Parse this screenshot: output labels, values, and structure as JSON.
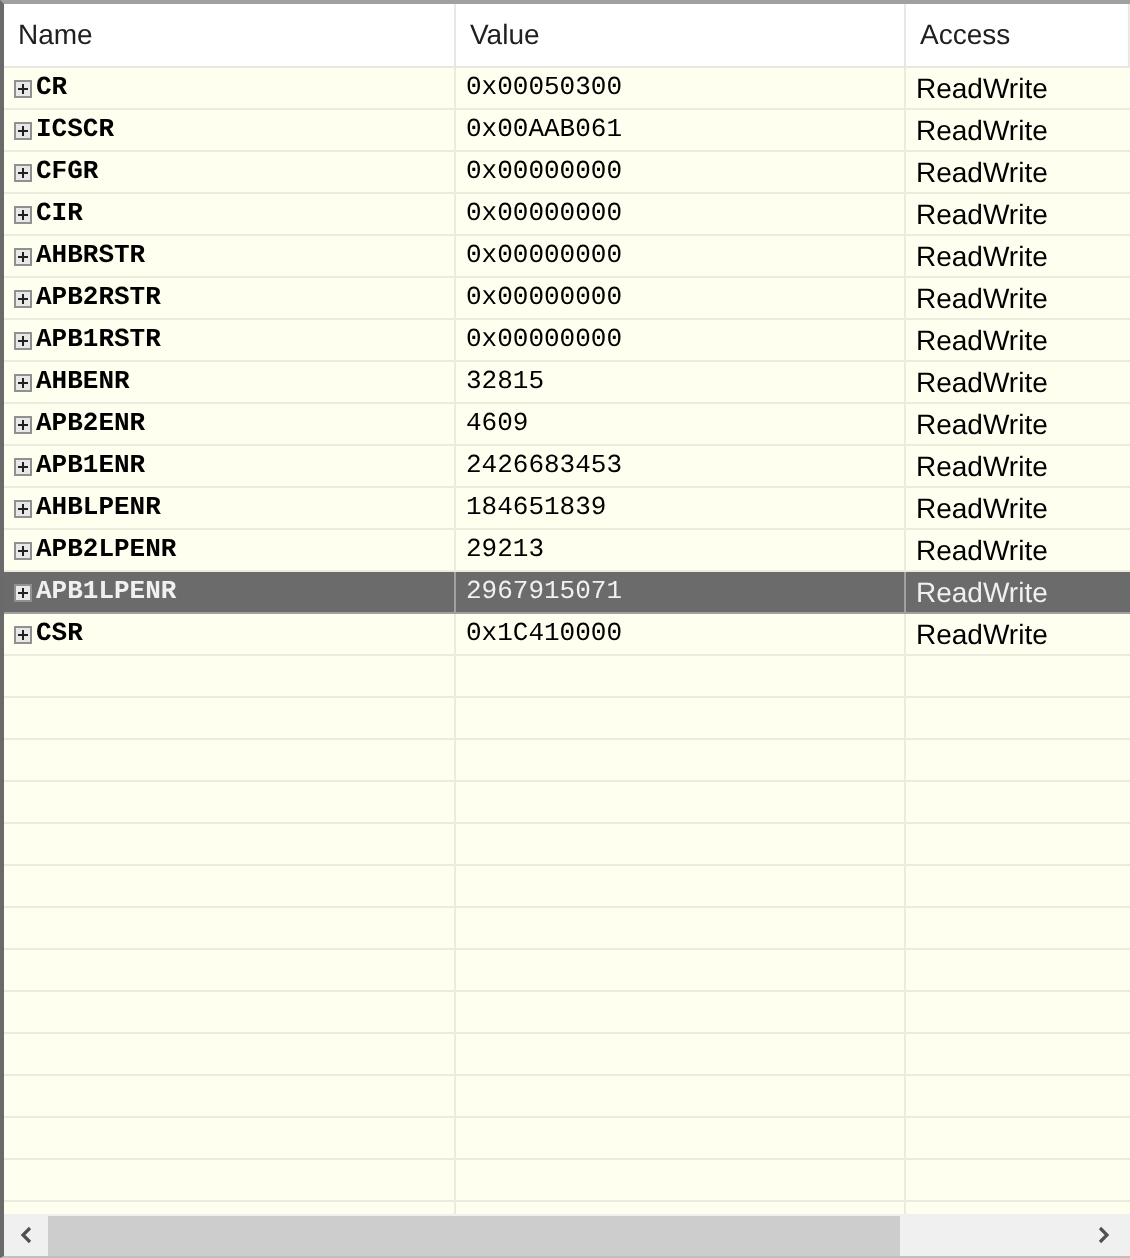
{
  "table": {
    "columns": [
      "Name",
      "Value",
      "Access"
    ],
    "rows": [
      {
        "name": "CR",
        "value": "0x00050300",
        "access": "ReadWrite",
        "expanded": false,
        "selected": false
      },
      {
        "name": "ICSCR",
        "value": "0x00AAB061",
        "access": "ReadWrite",
        "expanded": false,
        "selected": false
      },
      {
        "name": "CFGR",
        "value": "0x00000000",
        "access": "ReadWrite",
        "expanded": false,
        "selected": false
      },
      {
        "name": "CIR",
        "value": "0x00000000",
        "access": "ReadWrite",
        "expanded": false,
        "selected": false
      },
      {
        "name": "AHBRSTR",
        "value": "0x00000000",
        "access": "ReadWrite",
        "expanded": false,
        "selected": false
      },
      {
        "name": "APB2RSTR",
        "value": "0x00000000",
        "access": "ReadWrite",
        "expanded": false,
        "selected": false
      },
      {
        "name": "APB1RSTR",
        "value": "0x00000000",
        "access": "ReadWrite",
        "expanded": false,
        "selected": false
      },
      {
        "name": "AHBENR",
        "value": "32815",
        "access": "ReadWrite",
        "expanded": false,
        "selected": false
      },
      {
        "name": "APB2ENR",
        "value": "4609",
        "access": "ReadWrite",
        "expanded": false,
        "selected": false
      },
      {
        "name": "APB1ENR",
        "value": "2426683453",
        "access": "ReadWrite",
        "expanded": false,
        "selected": false
      },
      {
        "name": "AHBLPENR",
        "value": "184651839",
        "access": "ReadWrite",
        "expanded": false,
        "selected": false
      },
      {
        "name": "APB2LPENR",
        "value": "29213",
        "access": "ReadWrite",
        "expanded": false,
        "selected": false
      },
      {
        "name": "APB1LPENR",
        "value": "2967915071",
        "access": "ReadWrite",
        "expanded": false,
        "selected": true
      },
      {
        "name": "CSR",
        "value": "0x1C410000",
        "access": "ReadWrite",
        "expanded": false,
        "selected": false
      }
    ]
  }
}
